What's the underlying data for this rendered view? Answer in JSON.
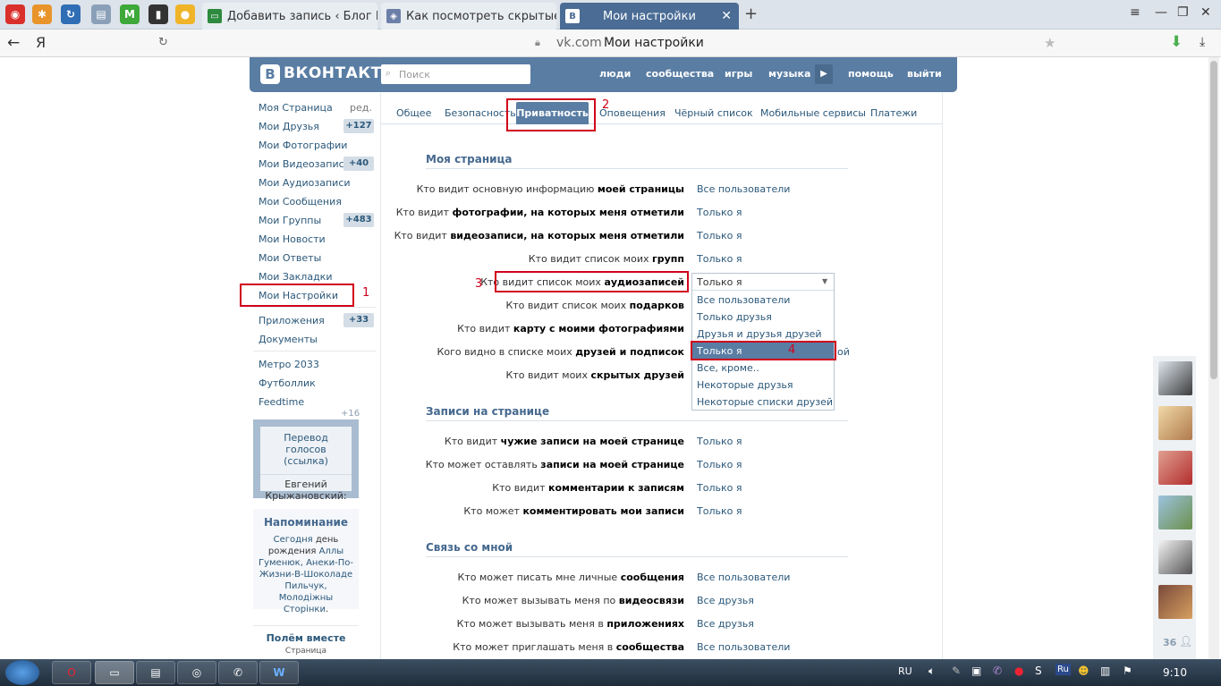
{
  "browser": {
    "tabs": [
      {
        "title": "Добавить запись ‹ Блог Евг"
      },
      {
        "title": "Как посмотреть скрытые а"
      },
      {
        "title": "Мои настройки"
      }
    ],
    "pinned_letters": [
      "",
      "",
      "",
      "",
      "M",
      "",
      ""
    ],
    "address": {
      "domain": "vk.com",
      "title": "Мои настройки"
    },
    "yandex_letter": "Я"
  },
  "vk": {
    "logo": "ВКОНТАКТЕ",
    "search_placeholder": "Поиск",
    "nav": [
      "люди",
      "сообщества",
      "игры",
      "музыка",
      "помощь",
      "выйти"
    ],
    "menu": [
      {
        "label": "Моя Страница",
        "extra": "ред."
      },
      {
        "label": "Мои Друзья",
        "badge": "+127"
      },
      {
        "label": "Мои Фотографии"
      },
      {
        "label": "Мои Видеозаписи",
        "badge": "+40"
      },
      {
        "label": "Мои Аудиозаписи"
      },
      {
        "label": "Мои Сообщения"
      },
      {
        "label": "Мои Группы",
        "badge": "+483"
      },
      {
        "label": "Мои Новости"
      },
      {
        "label": "Мои Ответы"
      },
      {
        "label": "Мои Закладки"
      },
      {
        "label": "Мои Настройки"
      },
      {
        "label": "Приложения",
        "badge": "+33"
      },
      {
        "label": "Документы"
      },
      {
        "label": "Метро 2033"
      },
      {
        "label": "Футболлик"
      },
      {
        "label": "Feedtime"
      }
    ],
    "apps_count": "+16",
    "voice_box": {
      "link": "Перевод голосов (ссылка)",
      "name": "Евгений Крыжановский:"
    },
    "reminder": {
      "title": "Напоминание",
      "today": "Сегодня",
      "text1": " день рождения ",
      "names": "Аллы Гуменюк, Анеки-По-Жизни-В-Шоколаде Пильчук, Молодiжны Сторiнки",
      "end": "."
    },
    "promo": {
      "title": "Полём вместе",
      "sub": "Страница"
    },
    "settings_tabs": [
      "Общее",
      "Безопасность",
      "Приватность",
      "Оповещения",
      "Чёрный список",
      "Мобильные сервисы",
      "Платежи"
    ],
    "sections": {
      "my_page": "Моя страница",
      "wall": "Записи на странице",
      "contact": "Связь со мной"
    },
    "rows_my_page": [
      {
        "pre": "Кто видит основную информацию ",
        "bold": "моей страницы",
        "value": "Все пользователи"
      },
      {
        "pre": "Кто видит ",
        "bold": "фотографии, на которых меня отметили",
        "value": "Только я"
      },
      {
        "pre": "Кто видит ",
        "bold": "видеозаписи, на которых меня отметили",
        "value": "Только я"
      },
      {
        "pre": "Кто видит список моих ",
        "bold": "групп",
        "value": "Только я"
      },
      {
        "pre": "Кто видит список моих ",
        "bold": "аудиозаписей",
        "value": "Только я"
      },
      {
        "pre": "Кто видит список моих ",
        "bold": "подарков",
        "value": ""
      },
      {
        "pre": "Кто видит ",
        "bold": "карту с моими фотографиями",
        "value": ""
      },
      {
        "pre": "Кого видно в списке моих ",
        "bold": "друзей и подписок",
        "value": ""
      },
      {
        "pre": "Кто видит моих ",
        "bold": "скрытых друзей",
        "value": ""
      }
    ],
    "hidden_tail": "ой",
    "rows_wall": [
      {
        "pre": "Кто видит ",
        "bold": "чужие записи на моей странице",
        "value": "Только я"
      },
      {
        "pre": "Кто может оставлять ",
        "bold": "записи на моей странице",
        "value": "Только я"
      },
      {
        "pre": "Кто видит ",
        "bold": "комментарии к записям",
        "value": "Только я"
      },
      {
        "pre": "Кто может ",
        "bold": "комментировать мои записи",
        "value": "Только я"
      }
    ],
    "rows_contact": [
      {
        "pre": "Кто может писать мне личные ",
        "bold": "сообщения",
        "value": "Все пользователи"
      },
      {
        "pre": "Кто может вызывать меня по ",
        "bold": "видеосвязи",
        "value": "Все друзья"
      },
      {
        "pre": "Кто может вызывать меня в ",
        "bold": "приложениях",
        "value": "Все друзья"
      },
      {
        "pre": "Кто может приглашать меня в ",
        "bold": "сообщества",
        "value": "Все пользователи"
      }
    ],
    "dropdown": {
      "current": "Только я",
      "options": [
        "Все пользователи",
        "Только друзья",
        "Друзья и друзья друзей",
        "Только я",
        "Все, кроме..",
        "Некоторые друзья",
        "Некоторые списки друзей"
      ],
      "highlighted_index": 3
    },
    "annotations": [
      "1",
      "2",
      "3",
      "4"
    ],
    "online_count": "36"
  },
  "taskbar": {
    "lang": "RU",
    "time": "9:10",
    "tray_ru": "Ru"
  },
  "colors": {
    "vk_blue": "#597da3",
    "link": "#2b587a",
    "annotation_red": "#d0021b"
  }
}
